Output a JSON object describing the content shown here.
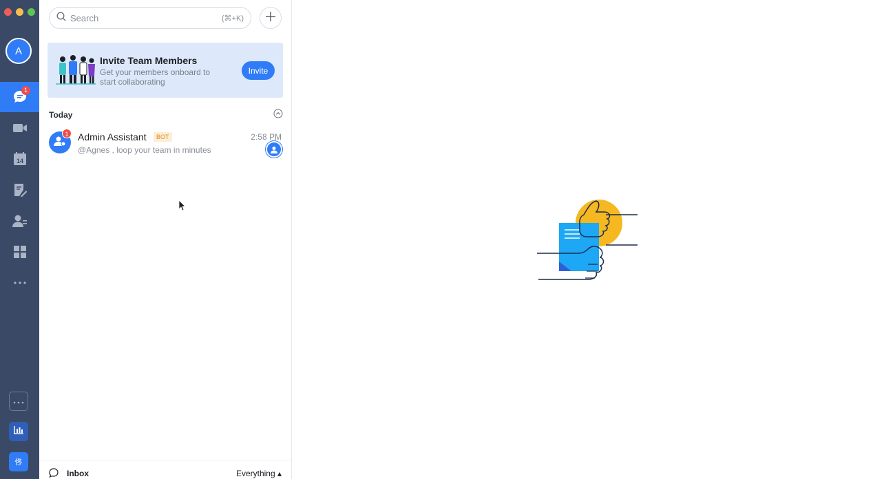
{
  "window": {
    "traffic_lights": [
      "#ee5e57",
      "#f5bd4f",
      "#5fc454"
    ]
  },
  "rail": {
    "avatar_letter": "A",
    "items": [
      {
        "name": "chat",
        "icon": "chat-icon",
        "badge": "1",
        "active": true
      },
      {
        "name": "meetings",
        "icon": "video-camera-icon"
      },
      {
        "name": "calendar",
        "icon": "calendar-icon",
        "date": "14"
      },
      {
        "name": "notes",
        "icon": "notes-icon"
      },
      {
        "name": "contacts",
        "icon": "contacts-icon"
      },
      {
        "name": "apps",
        "icon": "apps-grid-icon"
      },
      {
        "name": "more",
        "icon": "more-dots-icon"
      }
    ],
    "bottom": [
      {
        "name": "more-apps",
        "icon": "more-dots-icon"
      },
      {
        "name": "analytics",
        "icon": "bar-chart-icon"
      },
      {
        "name": "workspace",
        "icon": "workspace-icon",
        "glyph": "佟"
      }
    ]
  },
  "search": {
    "placeholder": "Search",
    "shortcut": "(⌘+K)"
  },
  "invite_banner": {
    "title": "Invite Team Members",
    "subtitle": "Get your members onboard to start collaborating",
    "button": "Invite"
  },
  "section": {
    "label": "Today"
  },
  "chats": [
    {
      "name": "Admin Assistant",
      "tag": "BOT",
      "time": "2:58 PM",
      "preview": "@Agnes , loop your team in minutes",
      "unread": "1"
    }
  ],
  "footer": {
    "inbox_label": "Inbox",
    "filter_label": "Everything ▴"
  },
  "colors": {
    "accent": "#2f7cf6",
    "rail": "#3a4a66",
    "badge": "#f04b4b",
    "banner": "#dde9fb",
    "hero_yellow": "#f5b820",
    "hero_blue": "#1ea7f5"
  }
}
